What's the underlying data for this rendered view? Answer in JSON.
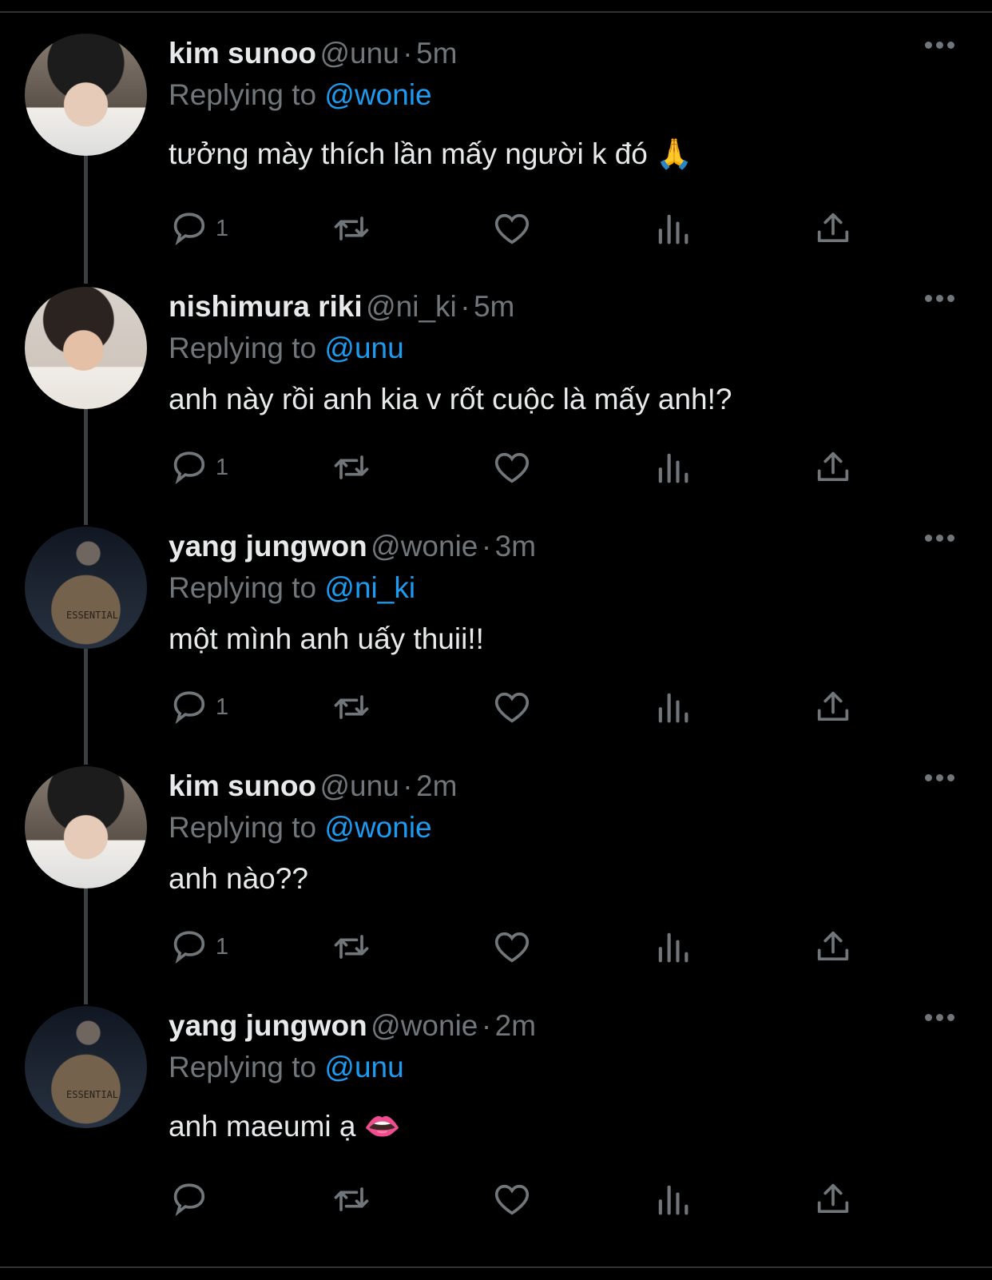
{
  "tweets": [
    {
      "name": "kim sunoo",
      "handle": "@unu",
      "sep": "·",
      "time": "5m",
      "reply_prefix": "Replying to",
      "reply_to": "@wonie",
      "text": "tưởng mày thích lần mấy người k đó",
      "emoji": "🙏",
      "emoji_icon": "folded-hands",
      "reply_count": "1",
      "avatar": "sunoo"
    },
    {
      "name": "nishimura riki",
      "handle": "@ni_ki",
      "sep": "·",
      "time": "5m",
      "reply_prefix": "Replying to",
      "reply_to": "@unu",
      "text": "anh này rồi anh kia v rốt cuộc là mấy anh!?",
      "emoji": "",
      "reply_count": "1",
      "avatar": "riki"
    },
    {
      "name": "yang jungwon",
      "handle": "@wonie",
      "sep": "·",
      "time": "3m",
      "reply_prefix": "Replying to",
      "reply_to": "@ni_ki",
      "text": "một mình anh uấy thuii!!",
      "emoji": "",
      "reply_count": "1",
      "avatar": "wonie"
    },
    {
      "name": "kim sunoo",
      "handle": "@unu",
      "sep": "·",
      "time": "2m",
      "reply_prefix": "Replying to",
      "reply_to": "@wonie",
      "text": "anh nào??",
      "emoji": "",
      "reply_count": "1",
      "avatar": "sunoo"
    },
    {
      "name": "yang jungwon",
      "handle": "@wonie",
      "sep": "·",
      "time": "2m",
      "reply_prefix": "Replying to",
      "reply_to": "@unu",
      "text": "anh maeumi ạ",
      "emoji": "👄",
      "emoji_icon": "lips",
      "reply_count": "",
      "avatar": "wonie"
    }
  ],
  "avatar_printed_text": "ESSENTIAL",
  "icons": {
    "reply": "reply-icon",
    "retweet": "retweet-icon",
    "like": "like-icon",
    "views": "views-icon",
    "share": "share-icon",
    "more": "more-icon"
  },
  "colors": {
    "background": "#000000",
    "text": "#e7e9ea",
    "muted": "#71767b",
    "accent": "#1d9bf0",
    "divider": "#2f3336"
  }
}
